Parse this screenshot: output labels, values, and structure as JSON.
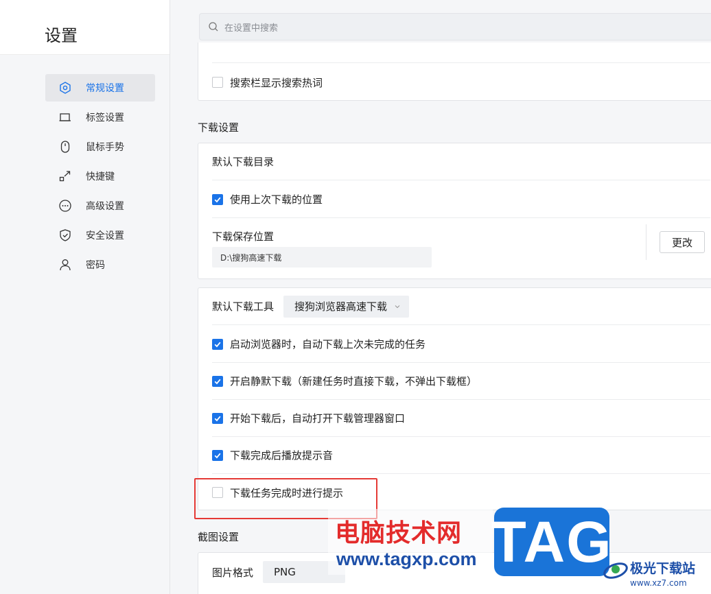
{
  "sidebar": {
    "title": "设置",
    "items": [
      {
        "label": "常规设置",
        "icon": "hexagon-gear-icon",
        "active": true
      },
      {
        "label": "标签设置",
        "icon": "tab-icon",
        "active": false
      },
      {
        "label": "鼠标手势",
        "icon": "mouse-icon",
        "active": false
      },
      {
        "label": "快捷键",
        "icon": "shortcut-icon",
        "active": false
      },
      {
        "label": "高级设置",
        "icon": "more-circle-icon",
        "active": false
      },
      {
        "label": "安全设置",
        "icon": "shield-icon",
        "active": false
      },
      {
        "label": "密码",
        "icon": "person-icon",
        "active": false
      }
    ]
  },
  "search": {
    "placeholder": "在设置中搜索"
  },
  "top_card": {
    "search_hot_words": {
      "label": "搜索栏显示搜索热词",
      "checked": false
    }
  },
  "download": {
    "section_title": "下载设置",
    "default_dir_title": "默认下载目录",
    "use_last_location": {
      "label": "使用上次下载的位置",
      "checked": true
    },
    "save_location_label": "下载保存位置",
    "save_path": "D:\\搜狗高速下载",
    "change_button": "更改",
    "default_tool_label": "默认下载工具",
    "default_tool_value": "搜狗浏览器高速下载",
    "options": [
      {
        "label": "启动浏览器时，自动下载上次未完成的任务",
        "checked": true
      },
      {
        "label": "开启静默下载（新建任务时直接下载，不弹出下载框）",
        "checked": true
      },
      {
        "label": "开始下载后，自动打开下载管理器窗口",
        "checked": true
      },
      {
        "label": "下载完成后播放提示音",
        "checked": true
      },
      {
        "label": "下载任务完成时进行提示",
        "checked": false
      }
    ]
  },
  "screenshot": {
    "section_title": "截图设置",
    "image_format_label": "图片格式",
    "image_format_value": "PNG"
  },
  "watermark": {
    "cn": "电脑技术网",
    "url": "www.tagxp.com",
    "tag": "TAG",
    "logo_name": "极光下载站",
    "logo_url": "www.xz7.com"
  },
  "colors": {
    "accent": "#1a73e8",
    "highlight": "#e53935"
  }
}
